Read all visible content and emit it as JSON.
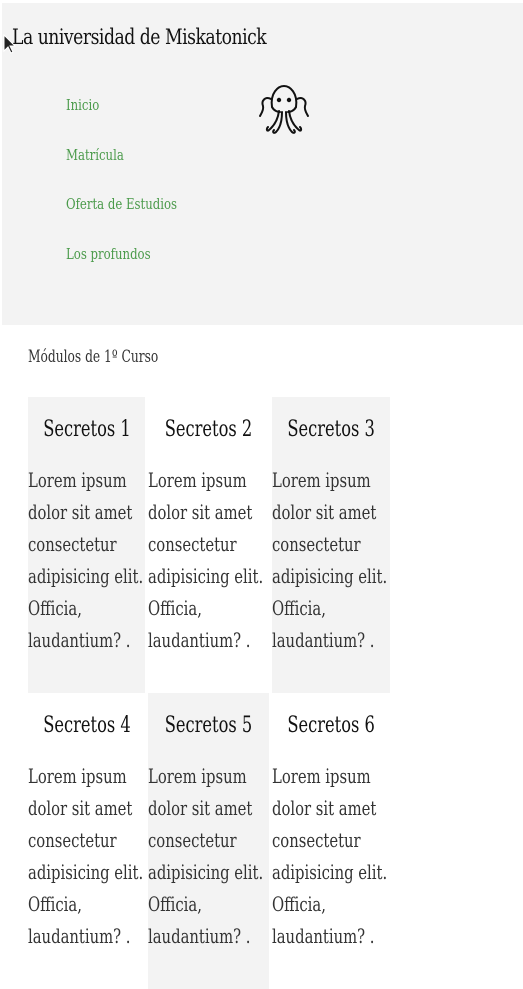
{
  "header": {
    "title": "La universidad de Miskatonick",
    "logo_icon": "cthulhu-icon",
    "nav": [
      {
        "label": "Inicio"
      },
      {
        "label": "Matrícula"
      },
      {
        "label": "Oferta de Estudios"
      },
      {
        "label": "Los profundos"
      }
    ]
  },
  "main": {
    "section_title": "Módulos de 1º Curso",
    "cards": [
      {
        "title": "Secretos 1",
        "text": "Lorem ipsum dolor sit amet consectetur adipisicing elit. Officia, laudantium? ."
      },
      {
        "title": "Secretos 2",
        "text": "Lorem ipsum dolor sit amet consectetur adipisicing elit. Officia, laudantium? ."
      },
      {
        "title": "Secretos 3",
        "text": "Lorem ipsum dolor sit amet consectetur adipisicing elit. Officia, laudantium? ."
      },
      {
        "title": "Secretos 4",
        "text": "Lorem ipsum dolor sit amet consectetur adipisicing elit. Officia, laudantium? ."
      },
      {
        "title": "Secretos 5",
        "text": "Lorem ipsum dolor sit amet consectetur adipisicing elit. Officia, laudantium? ."
      },
      {
        "title": "Secretos 6",
        "text": "Lorem ipsum dolor sit amet consectetur adipisicing elit. Officia, laudantium? ."
      }
    ]
  },
  "colors": {
    "header_bg": "#f3f3f3",
    "nav_link": "#4a9a4a",
    "card_bg": "#f3f3f3"
  }
}
